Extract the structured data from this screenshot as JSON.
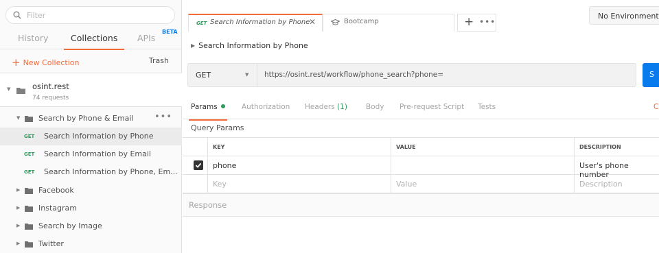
{
  "sidebar": {
    "filter_placeholder": "Filter",
    "tabs": {
      "history": "History",
      "collections": "Collections",
      "apis": "APIs",
      "beta": "BETA"
    },
    "new_collection": "New Collection",
    "trash": "Trash",
    "collection": {
      "name": "osint.rest",
      "count": "74 requests"
    },
    "folder_open": "Search by Phone & Email",
    "requests": [
      {
        "method": "GET",
        "label": "Search Information by Phone"
      },
      {
        "method": "GET",
        "label": "Search Information by Email"
      },
      {
        "method": "GET",
        "label": "Search Information by Phone, Em..."
      }
    ],
    "folders": [
      "Facebook",
      "Instagram",
      "Search by Image",
      "Twitter"
    ]
  },
  "tabs": {
    "active": {
      "method": "GET",
      "title": "Search Information by Phone",
      "close": "✕"
    },
    "second": {
      "title": "Bootcamp"
    },
    "plus": "+",
    "more": "•••"
  },
  "environment": "No Environment",
  "breadcrumb": "Search Information by Phone",
  "request": {
    "method": "GET",
    "url": "https://osint.rest/workflow/phone_search?phone=",
    "send": "S"
  },
  "request_tabs": {
    "params": "Params",
    "authorization": "Authorization",
    "headers": "Headers",
    "headers_count": "(1)",
    "body": "Body",
    "prerequest": "Pre-request Script",
    "tests": "Tests",
    "cookies": "C"
  },
  "query_params": {
    "title": "Query Params",
    "columns": {
      "key": "KEY",
      "value": "VALUE",
      "description": "DESCRIPTION"
    },
    "row": {
      "key": "phone",
      "value": "",
      "description": "User's phone number",
      "checked": true
    },
    "placeholders": {
      "key": "Key",
      "value": "Value",
      "description": "Description"
    }
  },
  "response": "Response"
}
